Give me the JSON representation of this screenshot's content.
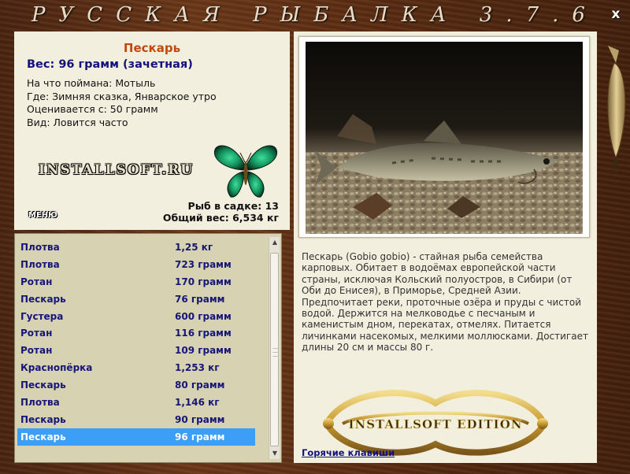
{
  "window": {
    "title": "РУССКАЯ РЫБАЛКА 3.7.6",
    "close_label": "x"
  },
  "fish": {
    "name": "Пескарь",
    "weight_line": "Вес: 96 грамм (зачетная)",
    "caught_with": "На что поймана: Мотыль",
    "location": "Где: Зимняя сказка, Январское утро",
    "valued_from": "Оценивается с: 50 грамм",
    "kind": "Вид: Ловится часто"
  },
  "brand": {
    "logo_text": "INSTALLSOFT.RU",
    "edition_text": "INSTALLSOFT EDITION"
  },
  "menu_label": "МЕНЮ",
  "stats": {
    "fish_in_cage": "Рыб в садке: 13",
    "total_weight": "Общий вес: 6,534 кг"
  },
  "catch_list": [
    {
      "name": "Плотва",
      "weight": "1,25 кг"
    },
    {
      "name": "Плотва",
      "weight": "723 грамм"
    },
    {
      "name": "Ротан",
      "weight": "170 грамм"
    },
    {
      "name": "Пескарь",
      "weight": "76 грамм"
    },
    {
      "name": "Густера",
      "weight": "600 грамм"
    },
    {
      "name": "Ротан",
      "weight": "116 грамм"
    },
    {
      "name": "Ротан",
      "weight": "109 грамм"
    },
    {
      "name": "Краснопёрка",
      "weight": "1,253 кг"
    },
    {
      "name": "Пескарь",
      "weight": "80 грамм"
    },
    {
      "name": "Плотва",
      "weight": "1,146 кг"
    },
    {
      "name": "Пескарь",
      "weight": "90 грамм"
    },
    {
      "name": "Пескарь",
      "weight": "96 грамм"
    }
  ],
  "selected_index": 11,
  "description": "Пескарь (Gobio gobio) - стайная рыба семейства карповых. Обитает в водоёмах европейской части страны, исключая Кольский полуостров, в Сибири (от Оби до Енисея), в Приморье, Средней Азии. Предпочитает реки, проточные озёра и пруды с чистой водой. Держится на мелководье с песчаным и каменистым дном, перекатах, отмелях. Питается личинками насекомых, мелкими моллюсками. Достигает длины 20 см и массы 80 г.",
  "hotkeys_label": "Горячие клавиши",
  "icons": {
    "close": "close-icon",
    "butterfly": "butterfly-icon",
    "lure": "lure-icon",
    "scroll_up": "chevron-up-icon",
    "scroll_down": "chevron-down-icon"
  },
  "colors": {
    "fish_name": "#c0490f",
    "weight_text": "#12127a",
    "list_text": "#16167a",
    "selection": "#3c9ef6",
    "panel_bg": "#f3efdf",
    "list_bg": "#d7d2b2",
    "frame": "#5a2c12"
  }
}
